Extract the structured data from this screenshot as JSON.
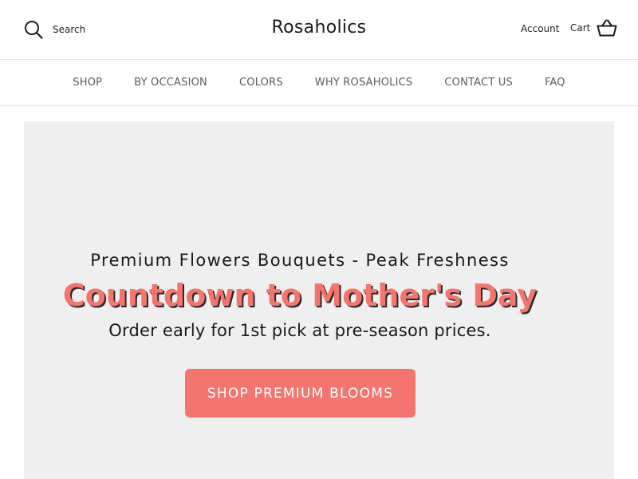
{
  "header": {
    "search_label": "Search",
    "logo": "Rosaholics",
    "account_label": "Account",
    "cart_label": "Cart"
  },
  "nav": {
    "items": [
      {
        "label": "SHOP"
      },
      {
        "label": "BY OCCASION"
      },
      {
        "label": "COLORS"
      },
      {
        "label": "WHY ROSAHOLICS"
      },
      {
        "label": "CONTACT US"
      },
      {
        "label": "FAQ"
      }
    ]
  },
  "hero": {
    "subtitle": "Premium Flowers Bouquets - Peak Freshness",
    "title": "Countdown to Mother's Day",
    "description": "Order early for 1st pick at pre-season prices.",
    "button_label": "SHOP PREMIUM BLOOMS"
  },
  "icons": {
    "search": "search-icon",
    "cart": "cart-basket-icon"
  },
  "colors": {
    "accent": "#f4756e",
    "hero_background": "#efefef",
    "nav_text": "#5a5a5a"
  }
}
